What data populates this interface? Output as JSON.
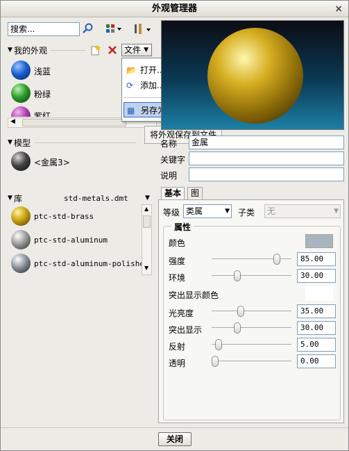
{
  "window": {
    "title": "外观管理器",
    "close_glyph": "×"
  },
  "search": {
    "placeholder": "搜索..."
  },
  "my_appearances": {
    "title": "我的外观",
    "file_button": "文件",
    "items": [
      {
        "label": "浅蓝",
        "color": "#1a5fd0"
      },
      {
        "label": "粉绿",
        "color": "#2e9a2e"
      },
      {
        "label": "紫红",
        "color": "#b040b0"
      }
    ]
  },
  "file_menu": {
    "items": [
      "打开...",
      "添加...",
      "另存为..."
    ],
    "selected": "另存为..."
  },
  "tooltip": "将外观保存到文件",
  "model": {
    "title": "模型",
    "items": [
      {
        "label": "<金属3>",
        "color": "#444"
      }
    ]
  },
  "library": {
    "title": "库",
    "file": "std-metals.dmt",
    "items": [
      {
        "label": "ptc-std-brass",
        "color": "#c9a010"
      },
      {
        "label": "ptc-std-aluminum",
        "color": "#9a9a9a"
      },
      {
        "label": "ptc-std-aluminum-polished",
        "color": "#8a8f9a"
      }
    ]
  },
  "properties_form": {
    "name_label": "名称",
    "name_value": "金属",
    "keyword_label": "关键字",
    "desc_label": "说明"
  },
  "tabs": [
    "基本",
    "图"
  ],
  "basic": {
    "grade_label": "等级",
    "grade_value": "类属",
    "subclass_label": "子类",
    "subclass_value": "无",
    "group_title": "属性",
    "color_label": "颜色",
    "color_swatch": "#aab4bf",
    "highlight_color_label": "突出显示颜色",
    "sliders": [
      {
        "label": "强度",
        "value": "85.00",
        "level": 0.85
      },
      {
        "label": "环境",
        "value": "30.00",
        "level": 0.3
      },
      {
        "label": "光亮度",
        "value": "35.00",
        "level": 0.35
      },
      {
        "label": "突出显示",
        "value": "30.00",
        "level": 0.3
      },
      {
        "label": "反射",
        "value": "5.00",
        "level": 0.05
      },
      {
        "label": "透明",
        "value": "0.00",
        "level": 0.0
      }
    ]
  },
  "footer": {
    "close_button": "关闭"
  }
}
